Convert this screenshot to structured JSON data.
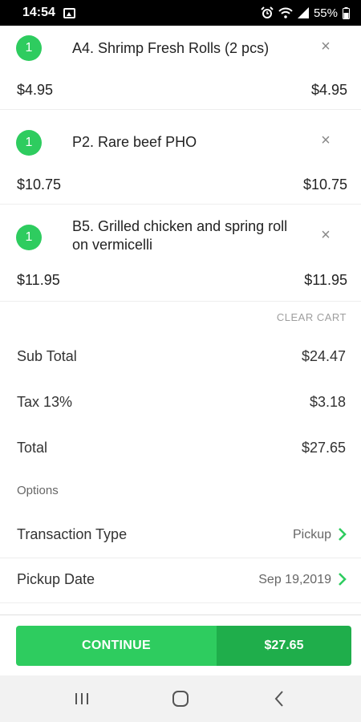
{
  "status_bar": {
    "time": "14:54",
    "battery": "55%"
  },
  "cart": {
    "items": [
      {
        "qty": "1",
        "name": "A4. Shrimp Fresh Rolls (2 pcs)",
        "unit_price": "$4.95",
        "line_total": "$4.95"
      },
      {
        "qty": "1",
        "name": "P2. Rare beef PHO",
        "unit_price": "$10.75",
        "line_total": "$10.75"
      },
      {
        "qty": "1",
        "name": "B5. Grilled chicken and spring roll on vermicelli",
        "unit_price": "$11.95",
        "line_total": "$11.95"
      }
    ],
    "clear_label": "CLEAR CART"
  },
  "summary": {
    "subtotal_label": "Sub Total",
    "subtotal": "$24.47",
    "tax_label": "Tax 13%",
    "tax": "$3.18",
    "total_label": "Total",
    "total": "$27.65"
  },
  "options": {
    "heading": "Options",
    "transaction_type_label": "Transaction Type",
    "transaction_type": "Pickup",
    "pickup_date_label": "Pickup Date",
    "pickup_date": "Sep 19,2019"
  },
  "continue_button": {
    "label": "CONTINUE",
    "amount": "$27.65"
  },
  "colors": {
    "accent": "#2ecc5f",
    "accent_dark": "#1fae4b"
  },
  "nav": {
    "icons": [
      "recent-apps-icon",
      "home-icon",
      "back-icon"
    ]
  }
}
